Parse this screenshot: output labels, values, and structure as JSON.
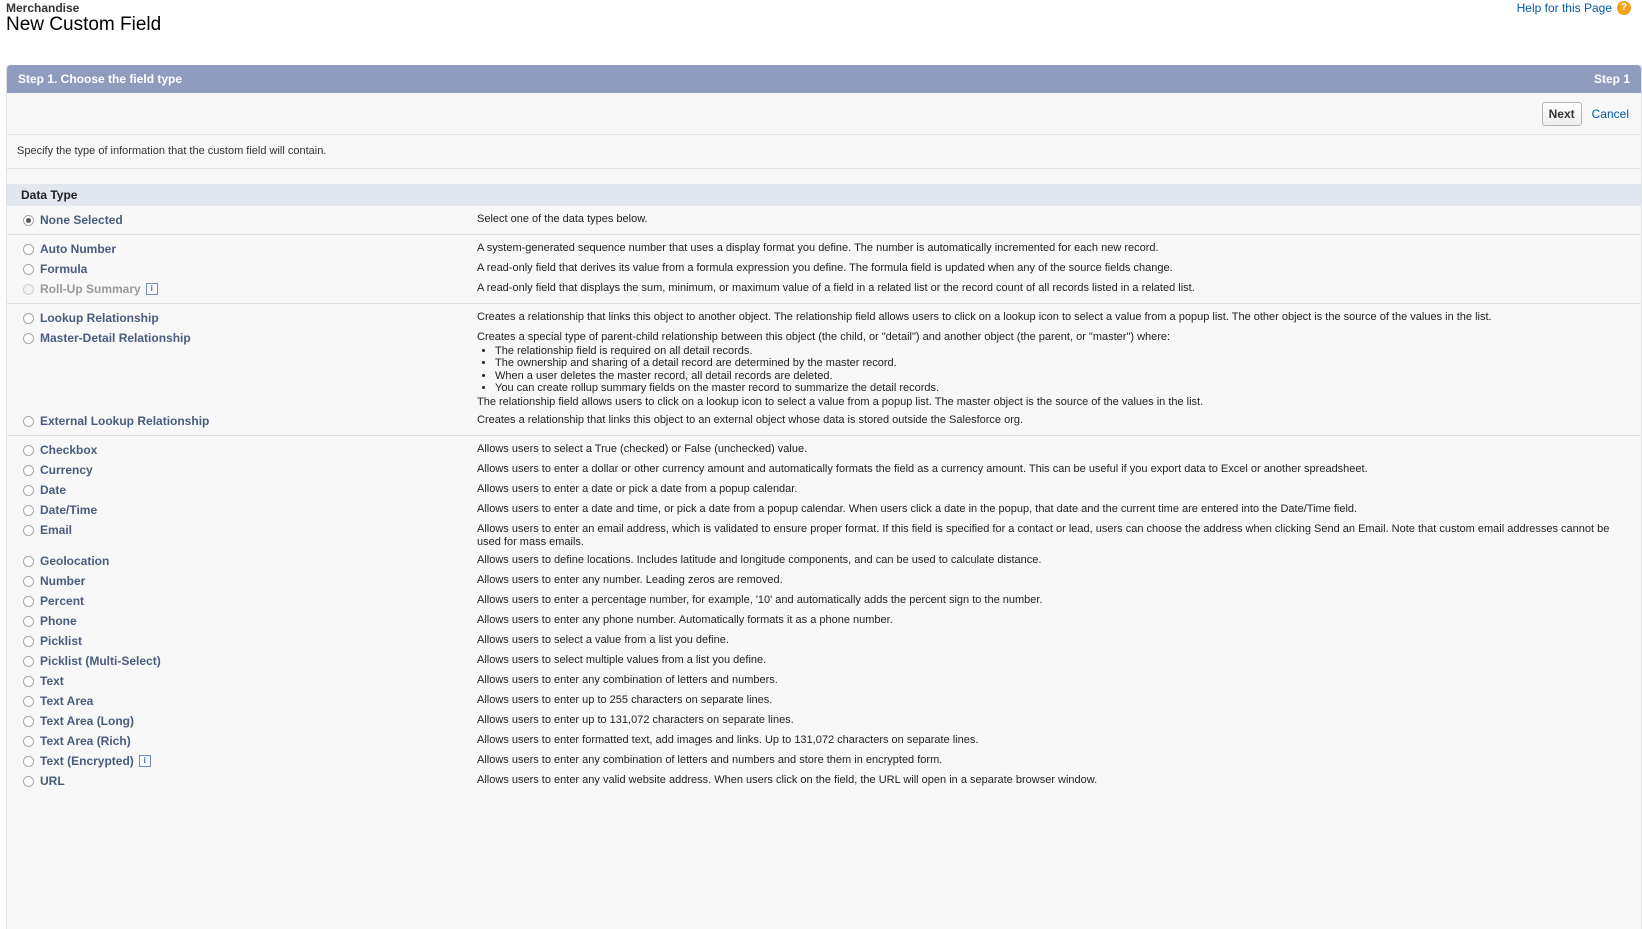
{
  "header": {
    "object_name": "Merchandise",
    "title": "New Custom Field",
    "help_link": "Help for this Page",
    "help_icon": "help-icon"
  },
  "step": {
    "title": "Step 1. Choose the field type",
    "indicator": "Step 1"
  },
  "buttons": {
    "next": "Next",
    "cancel": "Cancel"
  },
  "intro": "Specify the type of information that the custom field will contain.",
  "section_title": "Data Type",
  "options": {
    "none": {
      "label": "None Selected",
      "desc": "Select one of the data types below."
    },
    "autonumber": {
      "label": "Auto Number",
      "desc": "A system-generated sequence number that uses a display format you define. The number is automatically incremented for each new record."
    },
    "formula": {
      "label": "Formula",
      "desc": "A read-only field that derives its value from a formula expression you define. The formula field is updated when any of the source fields change."
    },
    "rollup": {
      "label": "Roll-Up Summary",
      "desc": "A read-only field that displays the sum, minimum, or maximum value of a field in a related list or the record count of all records listed in a related list."
    },
    "lookup": {
      "label": "Lookup Relationship",
      "desc": "Creates a relationship that links this object to another object. The relationship field allows users to click on a lookup icon to select a value from a popup list. The other object is the source of the values in the list."
    },
    "masterdetail": {
      "label": "Master-Detail Relationship",
      "desc_intro": "Creates a special type of parent-child relationship between this object (the child, or \"detail\") and another object (the parent, or \"master\") where:",
      "bullets": [
        "The relationship field is required on all detail records.",
        "The ownership and sharing of a detail record are determined by the master record.",
        "When a user deletes the master record, all detail records are deleted.",
        "You can create rollup summary fields on the master record to summarize the detail records."
      ],
      "desc_outro": "The relationship field allows users to click on a lookup icon to select a value from a popup list. The master object is the source of the values in the list."
    },
    "external": {
      "label": "External Lookup Relationship",
      "desc": "Creates a relationship that links this object to an external object whose data is stored outside the Salesforce org."
    },
    "checkbox": {
      "label": "Checkbox",
      "desc": "Allows users to select a True (checked) or False (unchecked) value."
    },
    "currency": {
      "label": "Currency",
      "desc": "Allows users to enter a dollar or other currency amount and automatically formats the field as a currency amount. This can be useful if you export data to Excel or another spreadsheet."
    },
    "date": {
      "label": "Date",
      "desc": "Allows users to enter a date or pick a date from a popup calendar."
    },
    "datetime": {
      "label": "Date/Time",
      "desc": "Allows users to enter a date and time, or pick a date from a popup calendar. When users click a date in the popup, that date and the current time are entered into the Date/Time field."
    },
    "email": {
      "label": "Email",
      "desc": "Allows users to enter an email address, which is validated to ensure proper format. If this field is specified for a contact or lead, users can choose the address when clicking Send an Email. Note that custom email addresses cannot be used for mass emails."
    },
    "geolocation": {
      "label": "Geolocation",
      "desc": "Allows users to define locations. Includes latitude and longitude components, and can be used to calculate distance."
    },
    "number": {
      "label": "Number",
      "desc": "Allows users to enter any number. Leading zeros are removed."
    },
    "percent": {
      "label": "Percent",
      "desc": "Allows users to enter a percentage number, for example, '10' and automatically adds the percent sign to the number."
    },
    "phone": {
      "label": "Phone",
      "desc": "Allows users to enter any phone number. Automatically formats it as a phone number."
    },
    "picklist": {
      "label": "Picklist",
      "desc": "Allows users to select a value from a list you define."
    },
    "multipicklist": {
      "label": "Picklist (Multi-Select)",
      "desc": "Allows users to select multiple values from a list you define."
    },
    "text": {
      "label": "Text",
      "desc": "Allows users to enter any combination of letters and numbers."
    },
    "textarea": {
      "label": "Text Area",
      "desc": "Allows users to enter up to 255 characters on separate lines."
    },
    "textarealong": {
      "label": "Text Area (Long)",
      "desc": "Allows users to enter up to 131,072 characters on separate lines."
    },
    "textarearich": {
      "label": "Text Area (Rich)",
      "desc": "Allows users to enter formatted text, add images and links. Up to 131,072 characters on separate lines."
    },
    "textencrypted": {
      "label": "Text (Encrypted)",
      "desc": "Allows users to enter any combination of letters and numbers and store them in encrypted form."
    },
    "url": {
      "label": "URL",
      "desc": "Allows users to enter any valid website address. When users click on the field, the URL will open in a separate browser window."
    }
  },
  "info_icon_glyph": "i"
}
